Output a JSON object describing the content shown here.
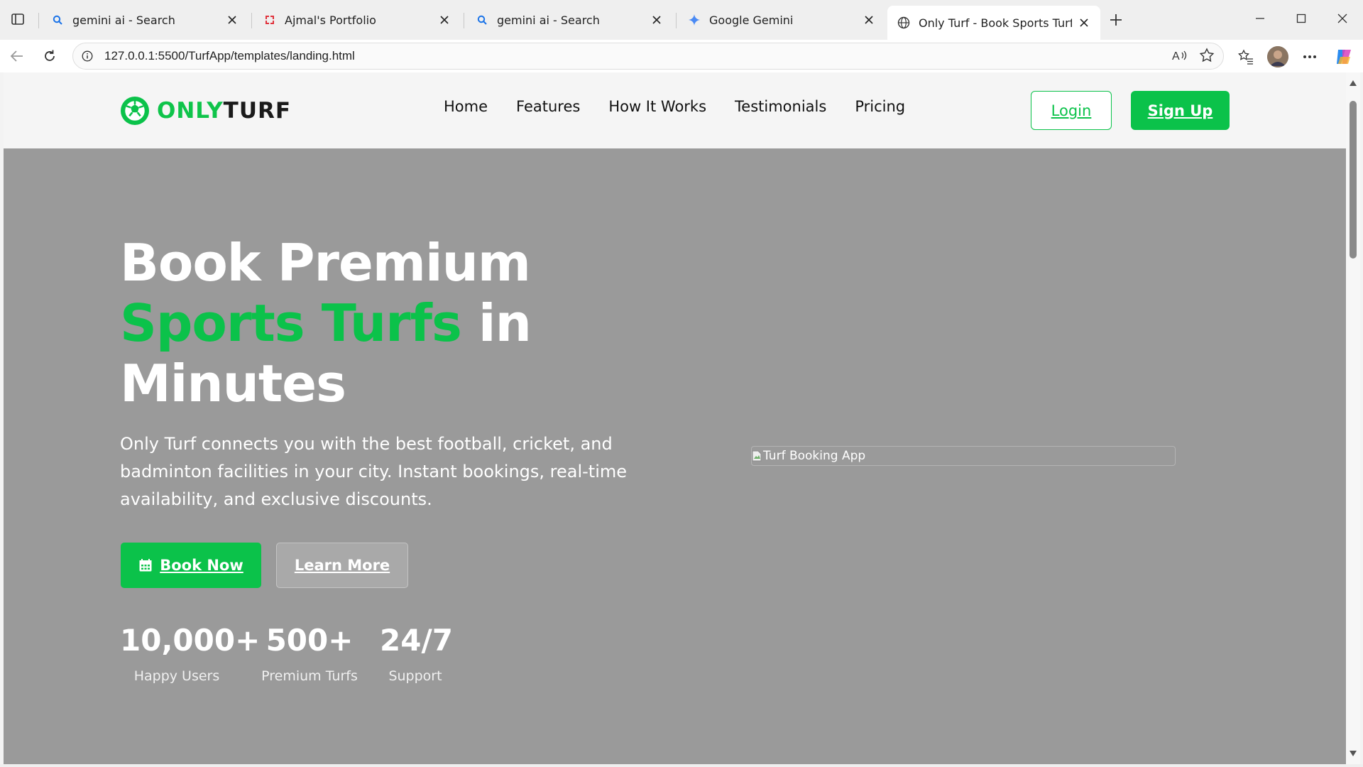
{
  "browser": {
    "tabs": [
      {
        "title": "gemini ai - Search",
        "icon": "search-icon"
      },
      {
        "title": "Ajmal's Portfolio",
        "icon": "portfolio-icon"
      },
      {
        "title": "gemini ai - Search",
        "icon": "search-icon"
      },
      {
        "title": "Google Gemini",
        "icon": "gemini-icon"
      },
      {
        "title": "Only Turf - Book Sports Turfs Inst",
        "icon": "globe-icon",
        "active": true
      }
    ],
    "address": "127.0.0.1:5500/TurfApp/templates/landing.html"
  },
  "site": {
    "logo": {
      "part1": "ONLY",
      "part2": "TURF"
    },
    "nav": [
      "Home",
      "Features",
      "How It Works",
      "Testimonials",
      "Pricing"
    ],
    "login": "Login",
    "signup": "Sign Up"
  },
  "hero": {
    "title_line1": "Book Premium",
    "title_accent": "Sports Turfs",
    "title_after_accent": " in",
    "title_line3": "Minutes",
    "description": "Only Turf connects you with the best football, cricket, and badminton facilities in your city. Instant bookings, real-time availability, and exclusive discounts.",
    "book_now": "Book Now",
    "learn_more": "Learn More",
    "image_alt": "Turf Booking App",
    "stats": [
      {
        "value": "10,000+",
        "label": "Happy Users"
      },
      {
        "value": "500+",
        "label": "Premium Turfs"
      },
      {
        "value": "24/7",
        "label": "Support"
      }
    ]
  },
  "colors": {
    "brand_green": "#0bc24a",
    "hero_bg": "#9a9a9a",
    "nav_bg": "#f5f5f5"
  }
}
